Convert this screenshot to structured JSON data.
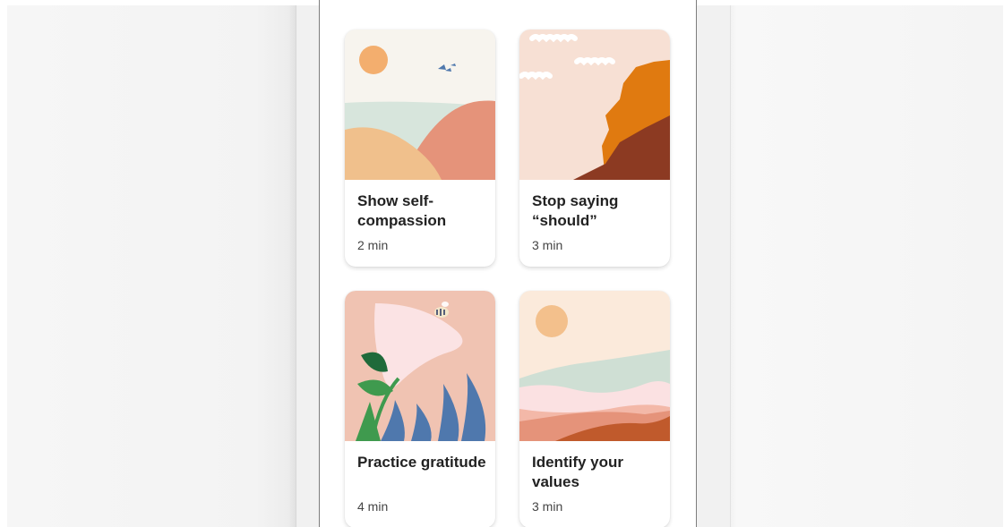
{
  "cards": [
    {
      "title": "Show self-compassion",
      "duration": "2 min",
      "illustration": "sun-hills-birds"
    },
    {
      "title": "Stop saying “should”",
      "duration": "3 min",
      "illustration": "cliff-clouds"
    },
    {
      "title": "Practice gratitude",
      "duration": "4 min",
      "illustration": "flower-bee-leaves"
    },
    {
      "title": "Identify your values",
      "duration": "3 min",
      "illustration": "sun-layered-landscape"
    }
  ],
  "colors": {
    "card_background": "#ffffff",
    "title_text": "#222222",
    "duration_text": "#444444",
    "peach": "#f2b07a",
    "terracotta": "#e5937a",
    "orange": "#e07a10",
    "rust": "#8c3a22",
    "blush": "#f0c3b2",
    "sage": "#cfdfd4",
    "blue": "#4f78ad",
    "green": "#3f9a4e"
  }
}
